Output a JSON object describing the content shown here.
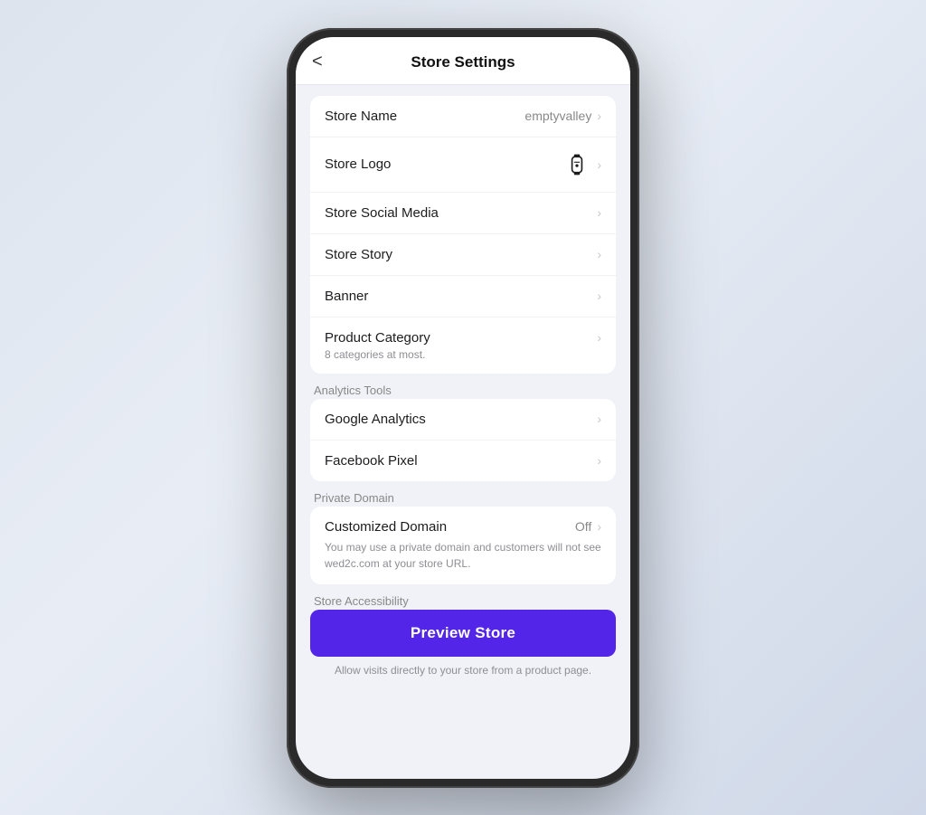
{
  "header": {
    "title": "Store Settings",
    "back_label": "<"
  },
  "items": [
    {
      "id": "store-name",
      "label": "Store Name",
      "value": "emptyvalley",
      "has_logo": false,
      "sublabel": null
    },
    {
      "id": "store-logo",
      "label": "Store Logo",
      "value": null,
      "has_logo": true,
      "sublabel": null
    },
    {
      "id": "store-social-media",
      "label": "Store Social Media",
      "value": null,
      "has_logo": false,
      "sublabel": null
    },
    {
      "id": "store-story",
      "label": "Store Story",
      "value": null,
      "has_logo": false,
      "sublabel": null
    },
    {
      "id": "banner",
      "label": "Banner",
      "value": null,
      "has_logo": false,
      "sublabel": null
    },
    {
      "id": "product-category",
      "label": "Product Category",
      "value": null,
      "has_logo": false,
      "sublabel": "8 categories at most."
    }
  ],
  "analytics_section": {
    "label": "Analytics Tools",
    "items": [
      {
        "id": "google-analytics",
        "label": "Google Analytics"
      },
      {
        "id": "facebook-pixel",
        "label": "Facebook Pixel"
      }
    ]
  },
  "private_domain_section": {
    "label": "Private Domain",
    "items": [
      {
        "id": "customized-domain",
        "label": "Customized Domain",
        "value": "Off",
        "note": "You may use a private domain and customers will not see wed2c.com at your store URL."
      }
    ]
  },
  "accessibility_section": {
    "label": "Store Accessibility",
    "preview_btn_label": "Preview Store",
    "domain_note": "Allow visits directly to your store from a product page."
  }
}
